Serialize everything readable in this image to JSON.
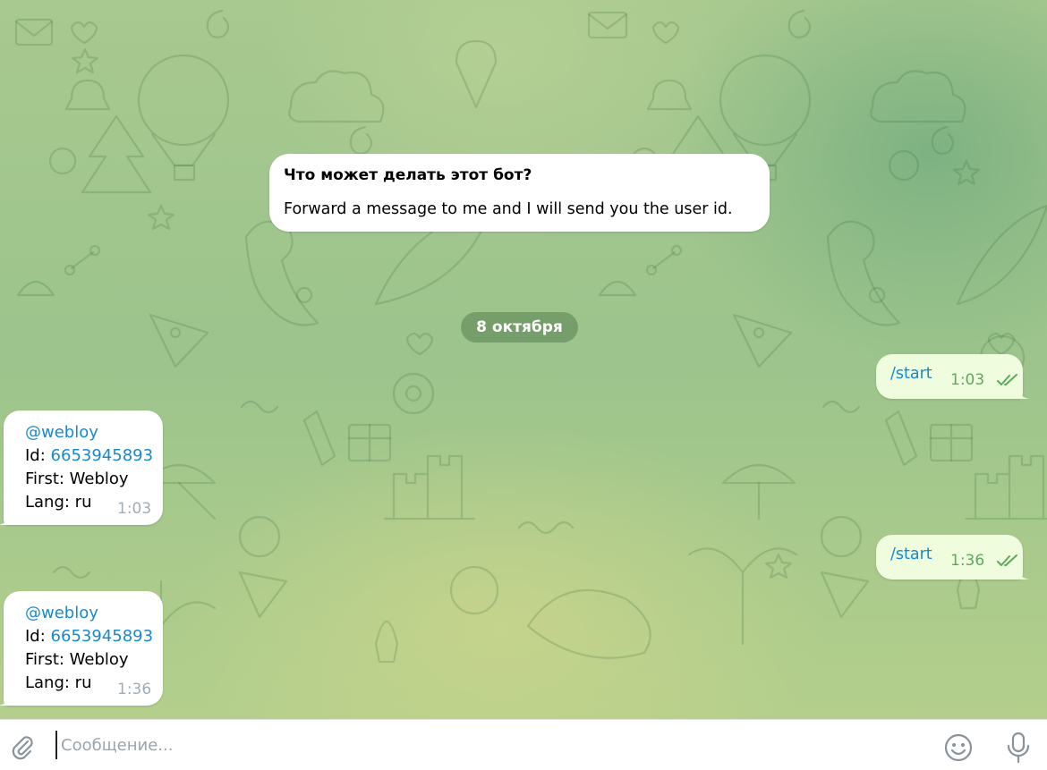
{
  "bot_info": {
    "title": "Что может делать этот бот?",
    "description": "Forward a message to me and I will send you the user id."
  },
  "date_separator": "8 октября",
  "messages": [
    {
      "direction": "out",
      "text": "/start",
      "time": "1:03",
      "status": "read"
    },
    {
      "direction": "in",
      "username": "@webloy",
      "id_label": "Id:",
      "id_value": "6653945893",
      "first": "First: Webloy",
      "lang": "Lang: ru",
      "time": "1:03"
    },
    {
      "direction": "out",
      "text": "/start",
      "time": "1:36",
      "status": "read"
    },
    {
      "direction": "in",
      "username": "@webloy",
      "id_label": "Id:",
      "id_value": "6653945893",
      "first": "First: Webloy",
      "lang": "Lang: ru",
      "time": "1:36"
    }
  ],
  "composer": {
    "placeholder": "Сообщение...",
    "attach_icon": "paperclip-icon",
    "emoji_icon": "smile-icon",
    "mic_icon": "microphone-icon"
  },
  "colors": {
    "link": "#168acd",
    "outgoing_bubble": "#effdde",
    "outgoing_time": "#5fa85e",
    "incoming_time": "#a0acb6",
    "date_pill": "#6e9a6a"
  }
}
